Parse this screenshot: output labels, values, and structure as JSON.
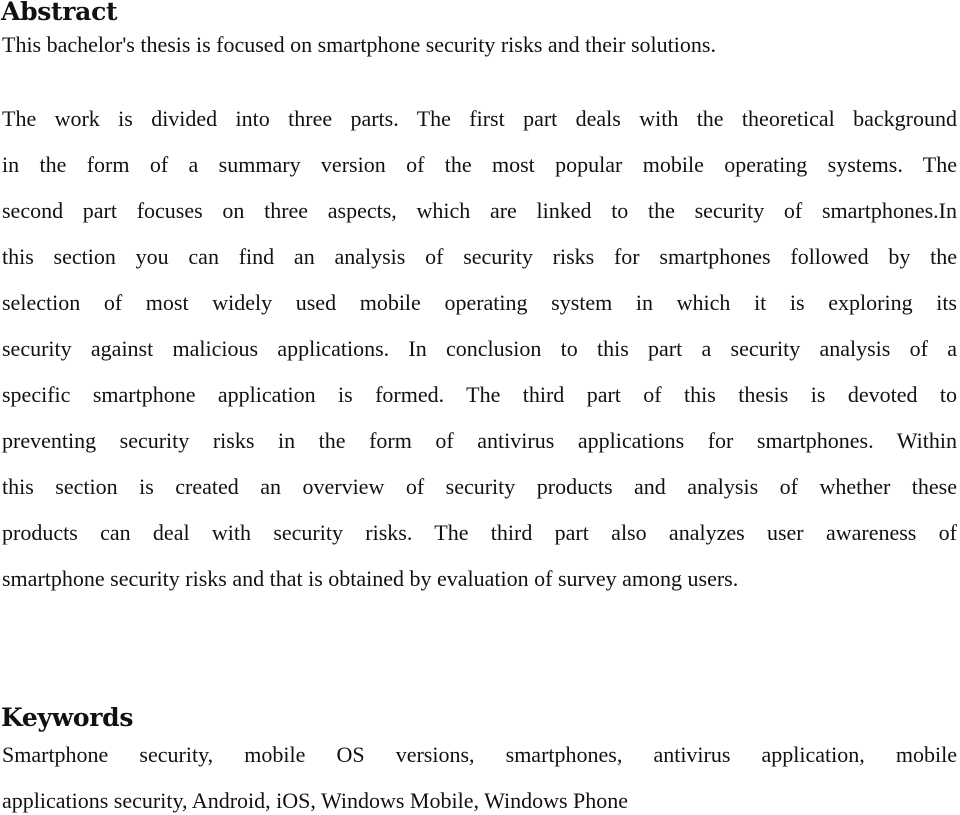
{
  "abstract": {
    "heading": "Abstract",
    "paragraph1": {
      "lines": [
        "This bachelor's thesis is focused on smartphone security risks and their solutions."
      ]
    },
    "paragraph2": {
      "lines": [
        "The work is divided into three parts. The first part deals with the theoretical background",
        "in the form of a summary version of the most popular mobile operating systems. The",
        "second part focuses on three aspects, which are linked to the security of smartphones.In",
        "this section you can find an analysis of security risks for smartphones followed by the",
        "selection of most widely used mobile operating system in which it is exploring its",
        "security against malicious applications. In conclusion to this part a security analysis of a",
        "specific smartphone application is formed. The third part of this thesis is devoted to",
        "preventing security risks in the form of antivirus applications for smartphones. Within",
        "this section is created an overview of security products and analysis of whether these",
        "products can deal with security risks. The third part also analyzes user awareness of",
        "smartphone security risks and that is obtained by evaluation of survey among users."
      ]
    }
  },
  "keywords": {
    "heading": "Keywords",
    "lines": [
      "Smartphone security, mobile OS versions, smartphones, antivirus application, mobile",
      "applications security, Android, iOS, Windows Mobile, Windows Phone"
    ]
  }
}
